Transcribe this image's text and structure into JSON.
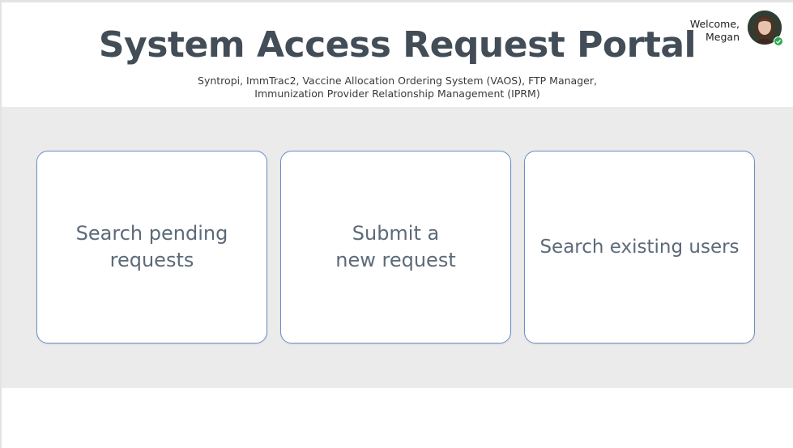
{
  "header": {
    "title": "System Access Request Portal",
    "subtitle_line1": "Syntropi, ImmTrac2, Vaccine Allocation Ordering System (VAOS), FTP Manager,",
    "subtitle_line2": "Immunization Provider Relationship Management (IPRM)"
  },
  "user": {
    "welcome_label": "Welcome,",
    "name": "Megan",
    "avatar_icon": "user-avatar-photo",
    "status": "online",
    "status_color": "#2fa84f"
  },
  "cards": [
    {
      "label": "Search pending\nrequests",
      "icon": "none"
    },
    {
      "label": "Submit a\nnew request",
      "icon": "none"
    },
    {
      "label": "Search existing users",
      "icon": "none"
    }
  ],
  "colors": {
    "title": "#424d57",
    "card_border": "#6b8fc6",
    "card_text": "#5c6a79",
    "band_background": "#ebebeb"
  }
}
